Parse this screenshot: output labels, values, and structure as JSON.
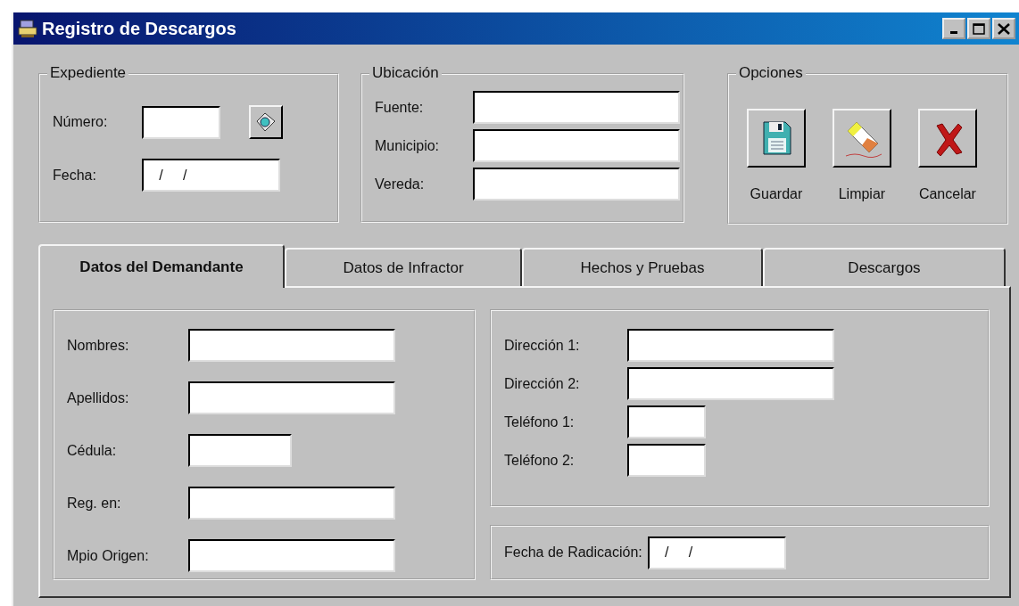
{
  "window": {
    "title": "Registro de Descargos"
  },
  "expediente": {
    "title": "Expediente",
    "fields": [
      {
        "label": "Número:"
      },
      {
        "label": "Fecha:",
        "value": "   /     /"
      }
    ]
  },
  "ubicacion": {
    "title": "Ubicación",
    "fields": [
      {
        "label": "Fuente:"
      },
      {
        "label": "Municipio:"
      },
      {
        "label": "Vereda:"
      }
    ]
  },
  "opciones": {
    "title": "Opciones",
    "buttons": [
      {
        "label": "Guardar",
        "kind": "save"
      },
      {
        "label": "Limpiar",
        "kind": "clear"
      },
      {
        "label": "Cancelar",
        "kind": "cancel"
      }
    ]
  },
  "tabs": [
    {
      "label": "Datos del Demandante",
      "selected": true
    },
    {
      "label": "Datos de Infractor",
      "selected": false
    },
    {
      "label": "Hechos y Pruebas",
      "selected": false
    },
    {
      "label": "Descargos",
      "selected": false
    }
  ],
  "demandante": {
    "left": [
      {
        "label": "Nombres:"
      },
      {
        "label": "Apellidos:"
      },
      {
        "label": "Cédula:"
      },
      {
        "label": "Reg. en:"
      },
      {
        "label": "Mpio Origen:"
      }
    ],
    "right": [
      {
        "label": "Dirección 1:"
      },
      {
        "label": "Dirección 2:"
      },
      {
        "label": "Teléfono 1:"
      },
      {
        "label": "Teléfono 2:"
      }
    ],
    "radicacion": {
      "label": "Fecha de Radicación:",
      "value": "   /     /"
    }
  }
}
